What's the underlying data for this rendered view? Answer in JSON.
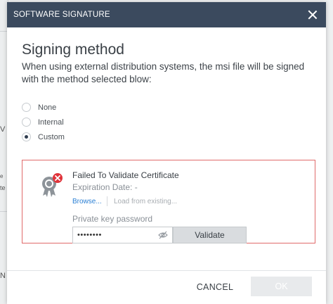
{
  "background": {
    "fragments": [
      "V",
      "e",
      "te",
      "N"
    ]
  },
  "dialog": {
    "title": "SOFTWARE SIGNATURE",
    "heading": "Signing method",
    "description": "When using external distribution systems, the msi file will be signed with the method selected blow:",
    "options": [
      {
        "label": "None",
        "selected": false
      },
      {
        "label": "Internal",
        "selected": false
      },
      {
        "label": "Custom",
        "selected": true
      }
    ],
    "certificate": {
      "status": "Failed To Validate Certificate",
      "expiration": "Expiration Date: -",
      "browse_label": "Browse...",
      "load_label": "Load from existing...",
      "password_label": "Private key password",
      "password_value": "••••••••",
      "validate_label": "Validate",
      "icon": "certificate-error-icon",
      "error_color": "#e0333a"
    },
    "footer": {
      "cancel_label": "CANCEL",
      "ok_label": "OK"
    }
  },
  "colors": {
    "titlebar": "#3b4a5e",
    "link": "#2a7fd4",
    "error_border": "#e06a6a"
  }
}
